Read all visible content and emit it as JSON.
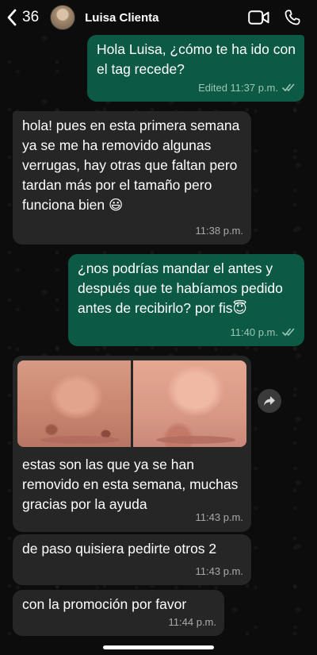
{
  "header": {
    "back_count": "36",
    "contact_name": "Luisa Clienta"
  },
  "messages": [
    {
      "direction": "outgoing",
      "text": "Hola Luisa, ¿cómo te ha ido con el tag recede?",
      "meta": "Edited 11:37 p.m.",
      "status": "read"
    },
    {
      "direction": "incoming",
      "text": "hola! pues en esta primera semana ya se me ha removido algunas verrugas, hay otras que faltan pero tardan más por el tamaño pero funciona bien 😃",
      "meta": "11:38 p.m."
    },
    {
      "direction": "outgoing",
      "text": "¿nos podrías mandar el antes y después que te habíamos pedido antes de recibirlo? por fis😇",
      "meta": "11:40 p.m.",
      "status": "read"
    },
    {
      "direction": "incoming",
      "type": "photo",
      "text": "estas son las que ya se han removido en esta semana, muchas gracias por la ayuda",
      "meta": "11:43 p.m."
    },
    {
      "direction": "incoming",
      "text": "de paso quisiera pedirte otros 2",
      "meta": "11:43 p.m."
    },
    {
      "direction": "incoming",
      "text": "con la promoción por favor",
      "meta": "11:44 p.m."
    }
  ],
  "colors": {
    "outgoing_bubble": "#0c5a45",
    "incoming_bubble": "#262626",
    "read_ticks": "#9cc5b6"
  },
  "icons": {
    "back": "chevron-left-icon",
    "video": "video-camera-icon",
    "call": "phone-icon",
    "forward": "share-forward-icon",
    "read": "double-check-icon"
  }
}
